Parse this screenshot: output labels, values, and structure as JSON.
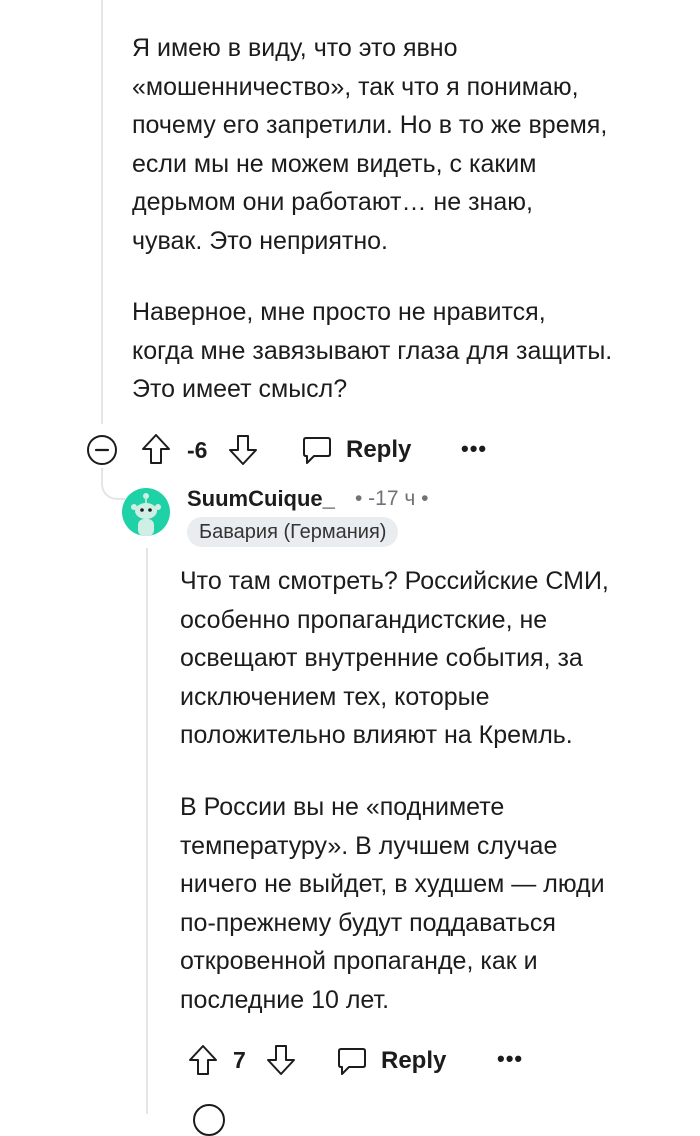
{
  "parent_comment": {
    "paragraphs": [
      "Я имею в виду, что это явно\n«мошенничество», так что я понимаю,\nпочему его запретили. Но в то же время,\nесли мы не можем видеть, с каким\nдерьмом они работают… не знаю,\nчувак. Это неприятно.",
      "Наверное, мне просто не нравится,\nкогда мне завязывают глаза для защиты.\nЭто имеет смысл?"
    ],
    "score": "-6",
    "reply_label": "Reply",
    "more_label": "•••"
  },
  "reply_comment": {
    "username": "SuumCuique_",
    "meta": "•  -17 ч  •",
    "flair": "Бавария (Германия)",
    "paragraphs": [
      "Что там смотреть? Российские СМИ,\nособенно пропагандистские, не\nосвещают внутренние события, за\nисключением тех, которые\nположительно влияют на Кремль.",
      "В России вы не «поднимете\nтемпературу». В лучшем случае\nничего не выйдет, в худшем — люди\nпо-прежнему будут поддаваться\nоткровенной пропаганде, как и\nпоследние 10 лет."
    ],
    "score": "7",
    "reply_label": "Reply",
    "more_label": "•••"
  },
  "colors": {
    "avatar_bg": "#1fd1a6",
    "thread_line": "#e5e5e5",
    "text": "#1c1c1c",
    "meta_text": "#6f7378",
    "flair_bg": "#eaedef"
  },
  "icons": [
    "collapse-minus-icon",
    "upvote-arrow-icon",
    "downvote-arrow-icon",
    "comment-bubble-icon",
    "more-dots-icon",
    "snoo-avatar-icon"
  ]
}
